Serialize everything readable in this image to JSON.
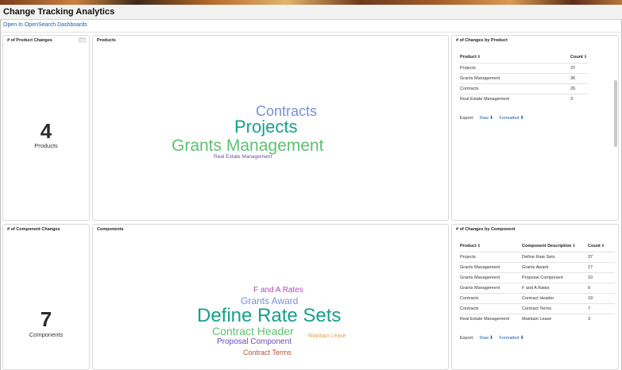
{
  "app": {
    "title": "Change Tracking Analytics",
    "open_link": "Open In OpenSearch Dashboards"
  },
  "product_count_panel": {
    "title": "# of Product Changes",
    "value": "4",
    "label": "Products",
    "menu_glyph": "···"
  },
  "products_cloud": {
    "title": "Products",
    "words": [
      {
        "text": "Contracts",
        "color": "#7b8fd4"
      },
      {
        "text": "Projects",
        "color": "#16a08c"
      },
      {
        "text": "Grants Management",
        "color": "#5fbf73"
      },
      {
        "text": "Real Estate Management",
        "color": "#6a4bb0"
      }
    ]
  },
  "changes_by_product": {
    "title": "# of Changes by Product",
    "columns": [
      "Product",
      "Count"
    ],
    "rows": [
      [
        "Projects",
        "37"
      ],
      [
        "Grants Management",
        "36"
      ],
      [
        "Contracts",
        "26"
      ],
      [
        "Real Estate Management",
        "3"
      ]
    ],
    "export_label": "Export:",
    "raw_label": "Raw",
    "formatted_label": "Formatted"
  },
  "component_count_panel": {
    "title": "# of Component Changes",
    "value": "7",
    "label": "Components"
  },
  "components_cloud": {
    "title": "Components",
    "words": [
      {
        "text": "F and A Rates",
        "color": "#b34ab8"
      },
      {
        "text": "Grants Award",
        "color": "#7b8fd4"
      },
      {
        "text": "Define Rate Sets",
        "color": "#16a08c"
      },
      {
        "text": "Contract Header",
        "color": "#5fbf73"
      },
      {
        "text": "Maintain Lease",
        "color": "#e0a04c"
      },
      {
        "text": "Proposal Component",
        "color": "#6a4bb0"
      },
      {
        "text": "Contract Terms",
        "color": "#b3513a"
      }
    ]
  },
  "changes_by_component": {
    "title": "# of Changes by Component",
    "columns": [
      "Product",
      "Component Description",
      "Count"
    ],
    "rows": [
      [
        "Projects",
        "Define Rate Sets",
        "37"
      ],
      [
        "Grants Management",
        "Grants Award",
        "17"
      ],
      [
        "Grants Management",
        "Proposal Component",
        "10"
      ],
      [
        "Grants Management",
        "F and A Rates",
        "9"
      ],
      [
        "Contracts",
        "Contract Header",
        "19"
      ],
      [
        "Contracts",
        "Contract Terms",
        "7"
      ],
      [
        "Real Estate Management",
        "Maintain Lease",
        "3"
      ]
    ],
    "export_label": "Export:",
    "raw_label": "Raw",
    "formatted_label": "Formatted"
  },
  "icons": {
    "sort": "sort-arrows-icon",
    "download": "download-icon",
    "menu": "ellipsis-icon"
  }
}
